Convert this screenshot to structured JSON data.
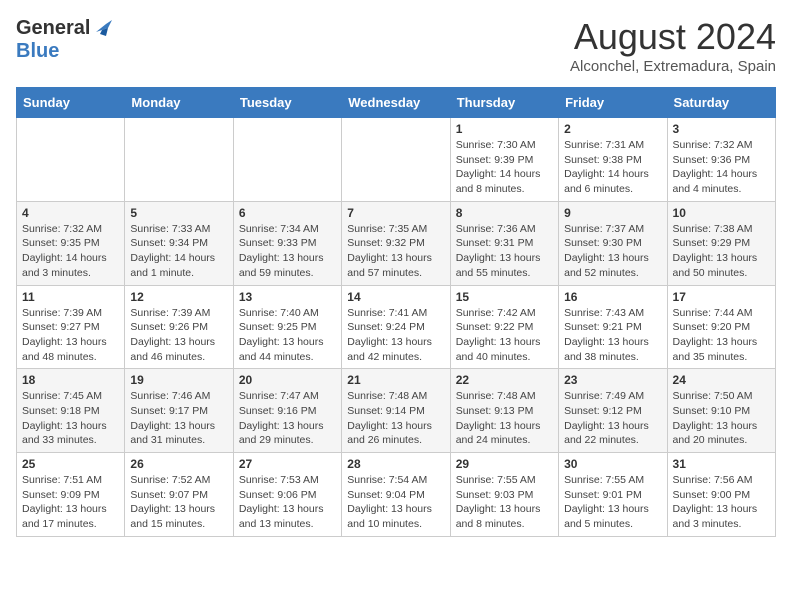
{
  "header": {
    "logo_general": "General",
    "logo_blue": "Blue",
    "month_year": "August 2024",
    "location": "Alconchel, Extremadura, Spain"
  },
  "weekdays": [
    "Sunday",
    "Monday",
    "Tuesday",
    "Wednesday",
    "Thursday",
    "Friday",
    "Saturday"
  ],
  "weeks": [
    [
      {
        "day": "",
        "info": ""
      },
      {
        "day": "",
        "info": ""
      },
      {
        "day": "",
        "info": ""
      },
      {
        "day": "",
        "info": ""
      },
      {
        "day": "1",
        "info": "Sunrise: 7:30 AM\nSunset: 9:39 PM\nDaylight: 14 hours\nand 8 minutes."
      },
      {
        "day": "2",
        "info": "Sunrise: 7:31 AM\nSunset: 9:38 PM\nDaylight: 14 hours\nand 6 minutes."
      },
      {
        "day": "3",
        "info": "Sunrise: 7:32 AM\nSunset: 9:36 PM\nDaylight: 14 hours\nand 4 minutes."
      }
    ],
    [
      {
        "day": "4",
        "info": "Sunrise: 7:32 AM\nSunset: 9:35 PM\nDaylight: 14 hours\nand 3 minutes."
      },
      {
        "day": "5",
        "info": "Sunrise: 7:33 AM\nSunset: 9:34 PM\nDaylight: 14 hours\nand 1 minute."
      },
      {
        "day": "6",
        "info": "Sunrise: 7:34 AM\nSunset: 9:33 PM\nDaylight: 13 hours\nand 59 minutes."
      },
      {
        "day": "7",
        "info": "Sunrise: 7:35 AM\nSunset: 9:32 PM\nDaylight: 13 hours\nand 57 minutes."
      },
      {
        "day": "8",
        "info": "Sunrise: 7:36 AM\nSunset: 9:31 PM\nDaylight: 13 hours\nand 55 minutes."
      },
      {
        "day": "9",
        "info": "Sunrise: 7:37 AM\nSunset: 9:30 PM\nDaylight: 13 hours\nand 52 minutes."
      },
      {
        "day": "10",
        "info": "Sunrise: 7:38 AM\nSunset: 9:29 PM\nDaylight: 13 hours\nand 50 minutes."
      }
    ],
    [
      {
        "day": "11",
        "info": "Sunrise: 7:39 AM\nSunset: 9:27 PM\nDaylight: 13 hours\nand 48 minutes."
      },
      {
        "day": "12",
        "info": "Sunrise: 7:39 AM\nSunset: 9:26 PM\nDaylight: 13 hours\nand 46 minutes."
      },
      {
        "day": "13",
        "info": "Sunrise: 7:40 AM\nSunset: 9:25 PM\nDaylight: 13 hours\nand 44 minutes."
      },
      {
        "day": "14",
        "info": "Sunrise: 7:41 AM\nSunset: 9:24 PM\nDaylight: 13 hours\nand 42 minutes."
      },
      {
        "day": "15",
        "info": "Sunrise: 7:42 AM\nSunset: 9:22 PM\nDaylight: 13 hours\nand 40 minutes."
      },
      {
        "day": "16",
        "info": "Sunrise: 7:43 AM\nSunset: 9:21 PM\nDaylight: 13 hours\nand 38 minutes."
      },
      {
        "day": "17",
        "info": "Sunrise: 7:44 AM\nSunset: 9:20 PM\nDaylight: 13 hours\nand 35 minutes."
      }
    ],
    [
      {
        "day": "18",
        "info": "Sunrise: 7:45 AM\nSunset: 9:18 PM\nDaylight: 13 hours\nand 33 minutes."
      },
      {
        "day": "19",
        "info": "Sunrise: 7:46 AM\nSunset: 9:17 PM\nDaylight: 13 hours\nand 31 minutes."
      },
      {
        "day": "20",
        "info": "Sunrise: 7:47 AM\nSunset: 9:16 PM\nDaylight: 13 hours\nand 29 minutes."
      },
      {
        "day": "21",
        "info": "Sunrise: 7:48 AM\nSunset: 9:14 PM\nDaylight: 13 hours\nand 26 minutes."
      },
      {
        "day": "22",
        "info": "Sunrise: 7:48 AM\nSunset: 9:13 PM\nDaylight: 13 hours\nand 24 minutes."
      },
      {
        "day": "23",
        "info": "Sunrise: 7:49 AM\nSunset: 9:12 PM\nDaylight: 13 hours\nand 22 minutes."
      },
      {
        "day": "24",
        "info": "Sunrise: 7:50 AM\nSunset: 9:10 PM\nDaylight: 13 hours\nand 20 minutes."
      }
    ],
    [
      {
        "day": "25",
        "info": "Sunrise: 7:51 AM\nSunset: 9:09 PM\nDaylight: 13 hours\nand 17 minutes."
      },
      {
        "day": "26",
        "info": "Sunrise: 7:52 AM\nSunset: 9:07 PM\nDaylight: 13 hours\nand 15 minutes."
      },
      {
        "day": "27",
        "info": "Sunrise: 7:53 AM\nSunset: 9:06 PM\nDaylight: 13 hours\nand 13 minutes."
      },
      {
        "day": "28",
        "info": "Sunrise: 7:54 AM\nSunset: 9:04 PM\nDaylight: 13 hours\nand 10 minutes."
      },
      {
        "day": "29",
        "info": "Sunrise: 7:55 AM\nSunset: 9:03 PM\nDaylight: 13 hours\nand 8 minutes."
      },
      {
        "day": "30",
        "info": "Sunrise: 7:55 AM\nSunset: 9:01 PM\nDaylight: 13 hours\nand 5 minutes."
      },
      {
        "day": "31",
        "info": "Sunrise: 7:56 AM\nSunset: 9:00 PM\nDaylight: 13 hours\nand 3 minutes."
      }
    ]
  ]
}
